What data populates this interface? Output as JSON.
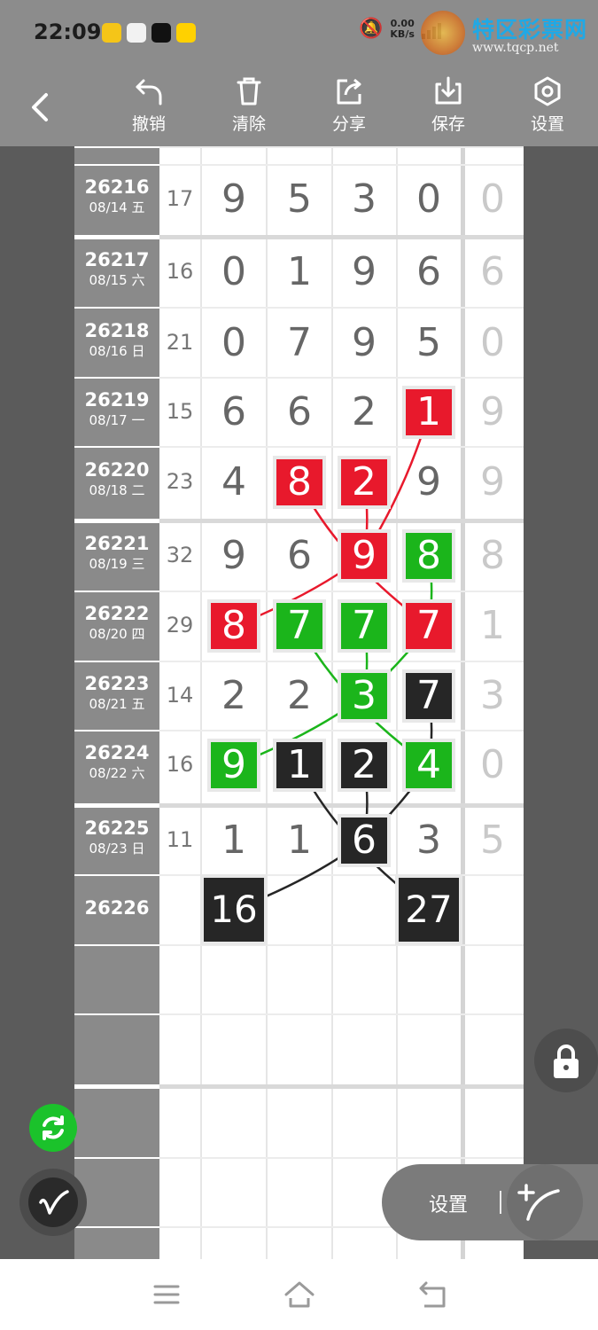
{
  "status": {
    "time": "22:09",
    "net_speed_value": "0.00",
    "net_speed_unit": "KB/s"
  },
  "watermark": {
    "title": "特区彩票网",
    "url": "www.tqcp.net"
  },
  "toolbar": {
    "undo_label": "撤销",
    "clear_label": "清除",
    "share_label": "分享",
    "save_label": "保存",
    "settings_label": "设置"
  },
  "colors": {
    "red": "#e8192c",
    "green": "#1bb51b",
    "black": "#262626",
    "toolbar": "#8c8c8c"
  },
  "rows": [
    {
      "period": "26216",
      "date": "08/14 五",
      "sum": "17",
      "digits": [
        "9",
        "5",
        "3",
        "0"
      ],
      "extra": "0"
    },
    {
      "period": "26217",
      "date": "08/15 六",
      "sum": "16",
      "digits": [
        "0",
        "1",
        "9",
        "6"
      ],
      "extra": "6"
    },
    {
      "period": "26218",
      "date": "08/16 日",
      "sum": "21",
      "digits": [
        "0",
        "7",
        "9",
        "5"
      ],
      "extra": "0"
    },
    {
      "period": "26219",
      "date": "08/17 一",
      "sum": "15",
      "digits": [
        "6",
        "6",
        "2",
        "1"
      ],
      "extra": "9"
    },
    {
      "period": "26220",
      "date": "08/18 二",
      "sum": "23",
      "digits": [
        "4",
        "8",
        "2",
        "9"
      ],
      "extra": "9"
    },
    {
      "period": "26221",
      "date": "08/19 三",
      "sum": "32",
      "digits": [
        "9",
        "6",
        "9",
        "8"
      ],
      "extra": "8"
    },
    {
      "period": "26222",
      "date": "08/20 四",
      "sum": "29",
      "digits": [
        "8",
        "7",
        "7",
        "7"
      ],
      "extra": "1"
    },
    {
      "period": "26223",
      "date": "08/21 五",
      "sum": "14",
      "digits": [
        "2",
        "2",
        "3",
        "7"
      ],
      "extra": "3"
    },
    {
      "period": "26224",
      "date": "08/22 六",
      "sum": "16",
      "digits": [
        "9",
        "1",
        "2",
        "4"
      ],
      "extra": "0"
    },
    {
      "period": "26225",
      "date": "08/23 日",
      "sum": "11",
      "digits": [
        "1",
        "1",
        "6",
        "3"
      ],
      "extra": "5"
    },
    {
      "period": "26226",
      "date": "",
      "sum": "",
      "digits": [
        "16",
        "",
        "",
        "27"
      ],
      "extra": ""
    }
  ],
  "highlights": [
    {
      "row": 3,
      "col": 3,
      "color": "red"
    },
    {
      "row": 4,
      "col": 1,
      "color": "red"
    },
    {
      "row": 4,
      "col": 2,
      "color": "red"
    },
    {
      "row": 5,
      "col": 2,
      "color": "red"
    },
    {
      "row": 5,
      "col": 3,
      "color": "green"
    },
    {
      "row": 6,
      "col": 0,
      "color": "red"
    },
    {
      "row": 6,
      "col": 1,
      "color": "green"
    },
    {
      "row": 6,
      "col": 2,
      "color": "green"
    },
    {
      "row": 6,
      "col": 3,
      "color": "red"
    },
    {
      "row": 7,
      "col": 2,
      "color": "green"
    },
    {
      "row": 7,
      "col": 3,
      "color": "black"
    },
    {
      "row": 8,
      "col": 0,
      "color": "green"
    },
    {
      "row": 8,
      "col": 1,
      "color": "black"
    },
    {
      "row": 8,
      "col": 2,
      "color": "black"
    },
    {
      "row": 8,
      "col": 3,
      "color": "green"
    },
    {
      "row": 9,
      "col": 2,
      "color": "black"
    },
    {
      "row": 10,
      "col": 0,
      "color": "black"
    },
    {
      "row": 10,
      "col": 3,
      "color": "black"
    }
  ],
  "connections": [
    {
      "from": [
        3,
        3
      ],
      "to": [
        5,
        2
      ],
      "color": "red"
    },
    {
      "from": [
        5,
        2
      ],
      "to": [
        6,
        0
      ],
      "color": "red"
    },
    {
      "from": [
        4,
        1
      ],
      "to": [
        6,
        3
      ],
      "color": "red"
    },
    {
      "from": [
        4,
        2
      ],
      "to": [
        5,
        2
      ],
      "color": "red"
    },
    {
      "from": [
        5,
        3
      ],
      "to": [
        6,
        3
      ],
      "color": "green"
    },
    {
      "from": [
        6,
        3
      ],
      "to": [
        7,
        2
      ],
      "color": "green"
    },
    {
      "from": [
        6,
        2
      ],
      "to": [
        7,
        2
      ],
      "color": "green"
    },
    {
      "from": [
        6,
        1
      ],
      "to": [
        8,
        3
      ],
      "color": "green"
    },
    {
      "from": [
        7,
        2
      ],
      "to": [
        8,
        0
      ],
      "color": "green"
    },
    {
      "from": [
        7,
        3
      ],
      "to": [
        8,
        3
      ],
      "color": "black"
    },
    {
      "from": [
        8,
        3
      ],
      "to": [
        9,
        2
      ],
      "color": "black"
    },
    {
      "from": [
        8,
        2
      ],
      "to": [
        9,
        2
      ],
      "color": "black"
    },
    {
      "from": [
        9,
        2
      ],
      "to": [
        10,
        0
      ],
      "color": "black"
    },
    {
      "from": [
        8,
        1
      ],
      "to": [
        10,
        3
      ],
      "color": "black"
    }
  ],
  "bottom_pill": {
    "settings_label": "设置"
  }
}
